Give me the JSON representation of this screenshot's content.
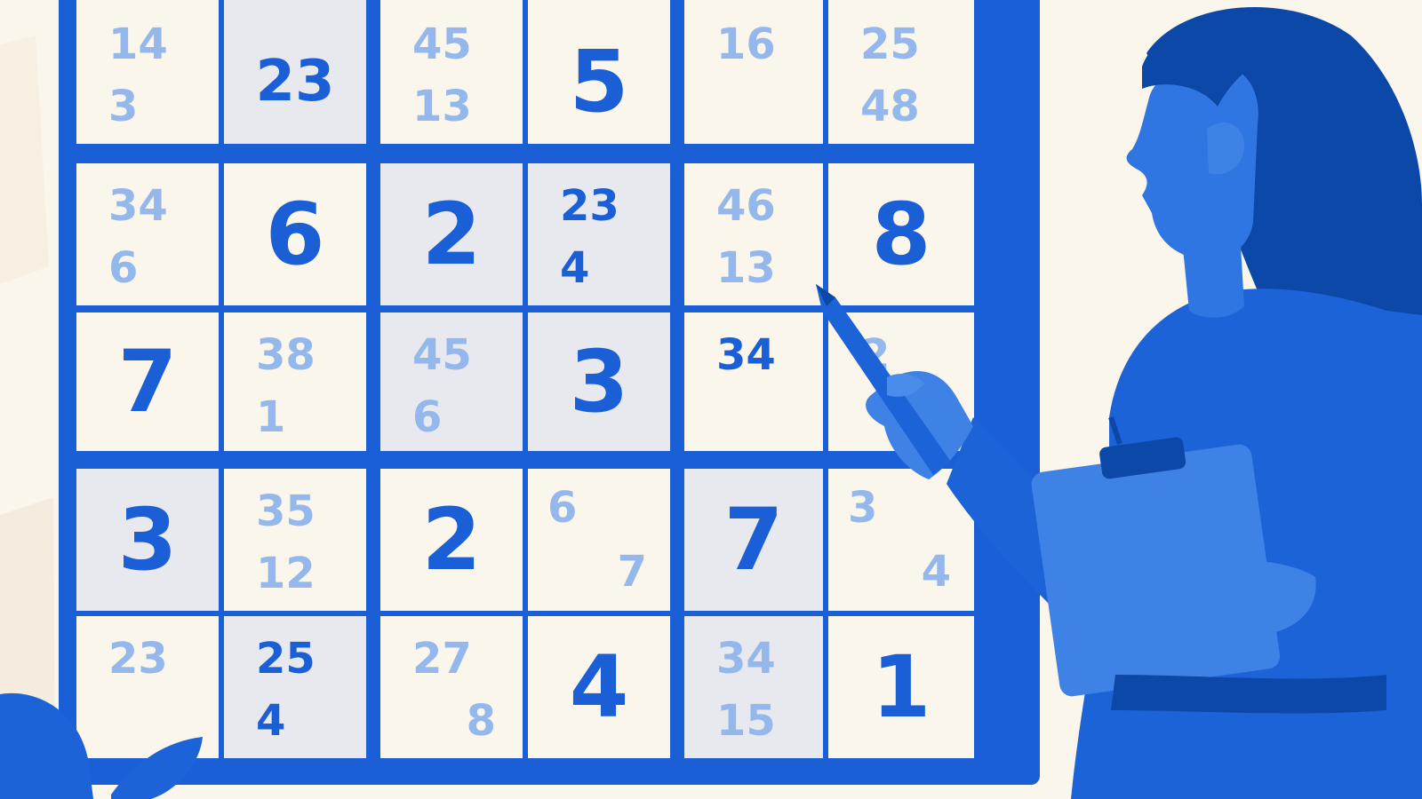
{
  "colors": {
    "background": "#fbf6ec",
    "grid": "#1a5fd6",
    "cell": "#fbf6ec",
    "cell_shaded": "#e8e9ee",
    "given_digit": "#1a5fd6",
    "pencil_mark": "#94b8ec",
    "figure_dark": "#0c48a8",
    "figure_mid": "#1d63d8",
    "figure_light": "#3f82e6"
  },
  "board": {
    "rows": [
      [
        {
          "notes": [
            "14",
            "3"
          ]
        },
        {
          "given": "23",
          "shaded": true,
          "small": true
        },
        {
          "notes": [
            "45",
            "13"
          ]
        },
        {
          "given": "5"
        },
        {
          "notes": [
            "16"
          ]
        },
        {
          "notes": [
            "25",
            "48"
          ]
        }
      ],
      [
        {
          "notes": [
            "34",
            "6"
          ]
        },
        {
          "given": "6"
        },
        {
          "given": "2",
          "shaded": true
        },
        {
          "notes": [
            "23",
            "4"
          ],
          "shaded": true,
          "dark": true
        },
        {
          "notes": [
            "46",
            "13"
          ]
        },
        {
          "given": "8"
        }
      ],
      [
        {
          "given": "7"
        },
        {
          "notes": [
            "38",
            "1"
          ]
        },
        {
          "notes": [
            "45",
            "6"
          ],
          "shaded": true
        },
        {
          "given": "3",
          "shaded": true
        },
        {
          "notes": [
            "34"
          ],
          "dark": true
        },
        {
          "notes": [
            "2"
          ]
        }
      ],
      [
        {
          "given": "3",
          "shaded": true
        },
        {
          "notes": [
            "35",
            "12"
          ]
        },
        {
          "given": "2"
        },
        {
          "notes": [
            "6",
            "7"
          ],
          "split": true
        },
        {
          "given": "7",
          "shaded": true
        },
        {
          "notes": [
            "3",
            "4"
          ],
          "split": true
        }
      ],
      [
        {
          "notes": [
            "23"
          ]
        },
        {
          "notes": [
            "25",
            "4"
          ],
          "shaded": true,
          "dark": true
        },
        {
          "notes": [
            "27",
            "8"
          ],
          "right2": true
        },
        {
          "given": "4"
        },
        {
          "notes": [
            "34",
            "15"
          ],
          "shaded": true
        },
        {
          "given": "1"
        }
      ]
    ]
  },
  "figure": {
    "holds": [
      "pencil-icon",
      "clipboard-icon"
    ]
  }
}
